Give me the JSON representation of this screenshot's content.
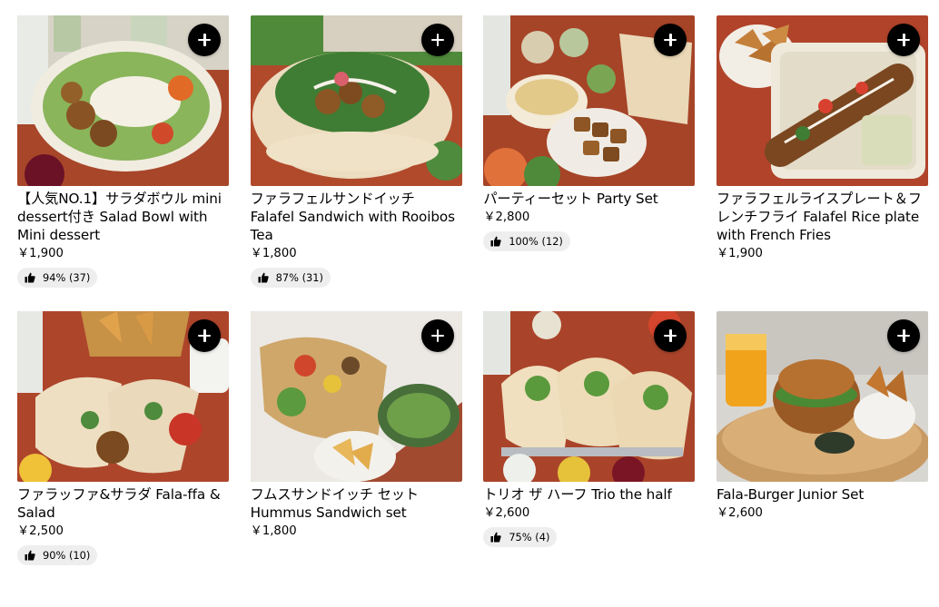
{
  "menu": {
    "items": [
      {
        "title": "【人気NO.1】サラダボウル mini dessert付き Salad Bowl with Mini dessert",
        "price": "￥1,900",
        "rating": "94% (37)",
        "image": "salad-bowl-photo",
        "add_icon": "plus-icon"
      },
      {
        "title": "ファラフェルサンドイッチ Falafel Sandwich with Rooibos Tea",
        "price": "￥1,800",
        "rating": "87% (31)",
        "image": "falafel-pita-photo",
        "add_icon": "plus-icon"
      },
      {
        "title": "パーティーセット Party Set",
        "price": "￥2,800",
        "rating": "100% (12)",
        "image": "party-set-photo",
        "add_icon": "plus-icon"
      },
      {
        "title": "ファラフェルライスプレート＆フレンチフライ Falafel Rice plate with French Fries",
        "price": "￥1,900",
        "rating": null,
        "image": "rice-plate-photo",
        "add_icon": "plus-icon"
      },
      {
        "title": "ファラッファ&サラダ Fala-ffa & Salad",
        "price": "￥2,500",
        "rating": "90% (10)",
        "image": "wrap-photo",
        "add_icon": "plus-icon"
      },
      {
        "title": "フムスサンドイッチ セット Hummus Sandwich set",
        "price": "￥1,800",
        "rating": null,
        "image": "hummus-sandwich-photo",
        "add_icon": "plus-icon"
      },
      {
        "title": "トリオ ザ ハーフ Trio the half",
        "price": "￥2,600",
        "rating": "75% (4)",
        "image": "trio-pita-photo",
        "add_icon": "plus-icon"
      },
      {
        "title": "Fala-Burger Junior Set",
        "price": "￥2,600",
        "rating": null,
        "image": "burger-set-photo",
        "add_icon": "plus-icon"
      }
    ]
  },
  "colors": {
    "button_bg": "#000000",
    "button_icon": "#ffffff",
    "rating_pill_bg": "#eeeeee",
    "text": "#000000"
  }
}
